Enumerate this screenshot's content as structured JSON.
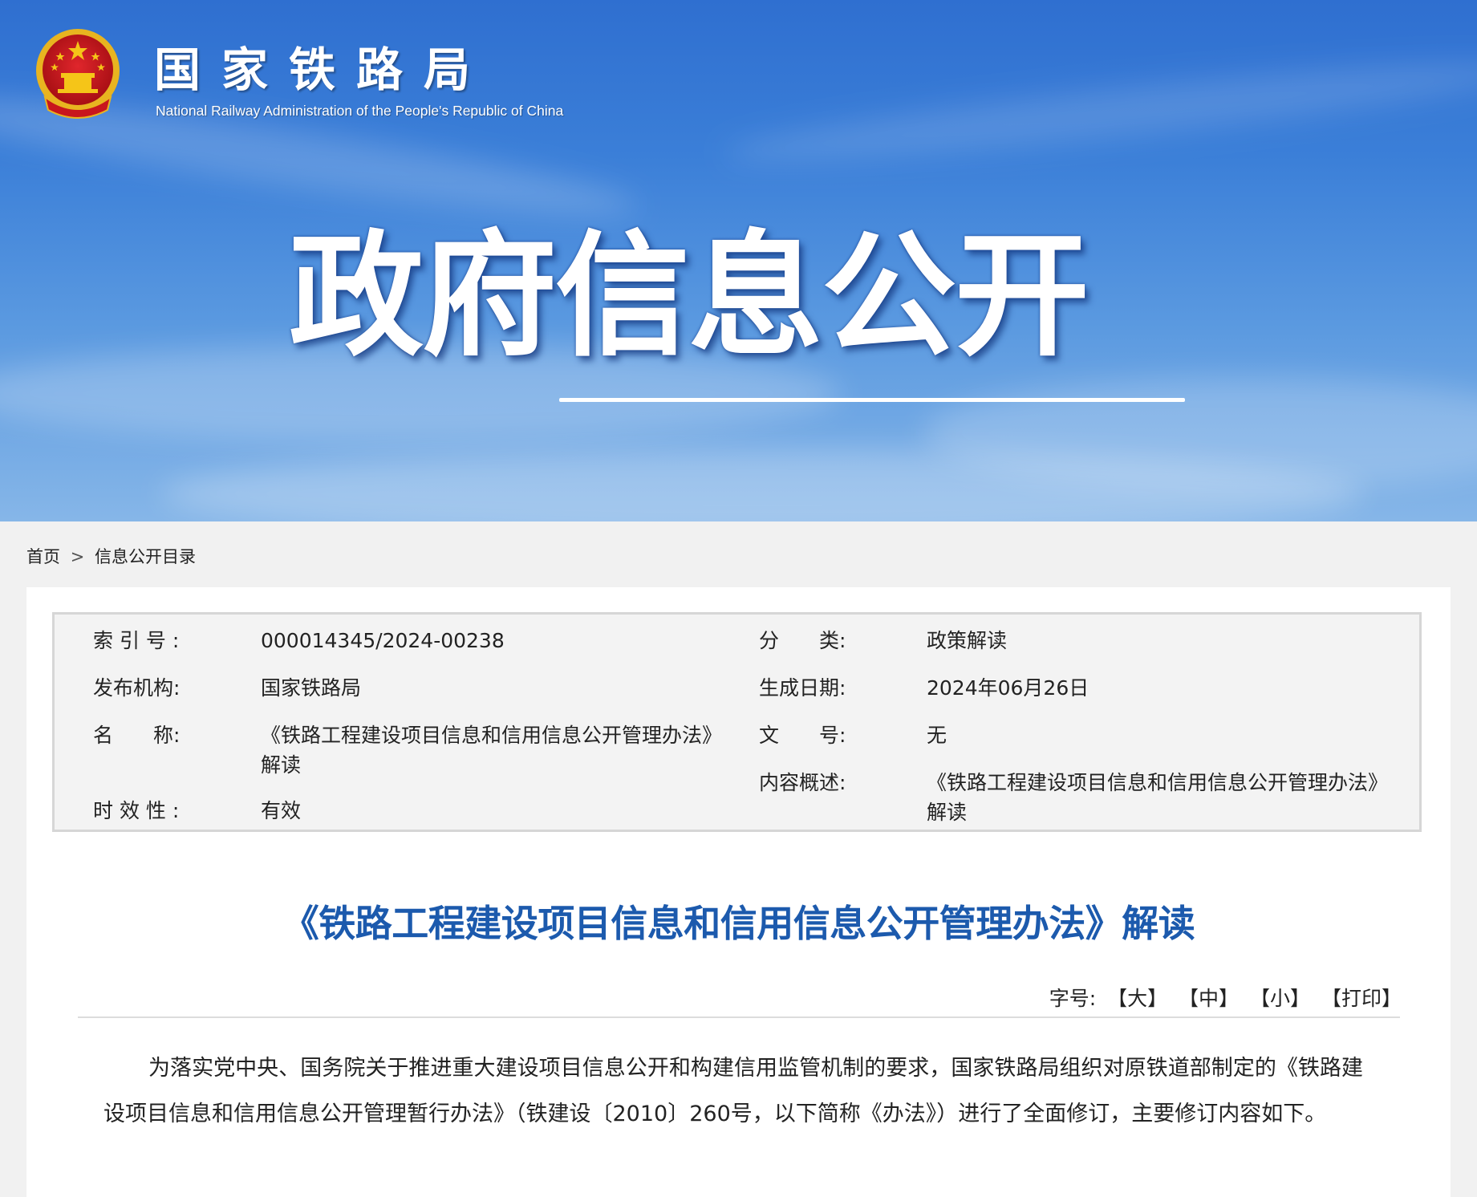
{
  "header": {
    "logo_cn": "国家铁路局",
    "logo_en": "National Railway Administration of the People's Republic of China",
    "banner_title": "政府信息公开"
  },
  "breadcrumb": {
    "home": "首页",
    "separator": ">",
    "current": "信息公开目录"
  },
  "info": {
    "index_label": "索 引 号 :",
    "index_value": "000014345/2024-00238",
    "category_label": "分　　类:",
    "category_value": "政策解读",
    "publisher_label": "发布机构:",
    "publisher_value": "国家铁路局",
    "date_label": "生成日期:",
    "date_value": "2024年06月26日",
    "name_label": "名　　称:",
    "name_value": "《铁路工程建设项目信息和信用信息公开管理办法》解读",
    "doc_no_label": "文　　号:",
    "doc_no_value": "无",
    "summary_label": "内容概述:",
    "summary_value": "《铁路工程建设项目信息和信用信息公开管理办法》解读",
    "validity_label": "时 效 性 :",
    "validity_value": "有效"
  },
  "article": {
    "title": "《铁路工程建设项目信息和信用信息公开管理办法》解读",
    "font_size_label": "字号:",
    "large": "【大】",
    "medium": "【中】",
    "small": "【小】",
    "print": "【打印】",
    "paragraph": "为落实党中央、国务院关于推进重大建设项目信息公开和构建信用监管机制的要求，国家铁路局组织对原铁道部制定的《铁路建设项目信息和信用信息公开管理暂行办法》（铁建设〔2010〕260号，以下简称《办法》）进行了全面修订，主要修订内容如下。"
  },
  "colors": {
    "banner_blue": "#3b7fd8",
    "title_blue": "#1c5aad",
    "emblem_red": "#c8161d",
    "emblem_gold": "#f5c518"
  }
}
